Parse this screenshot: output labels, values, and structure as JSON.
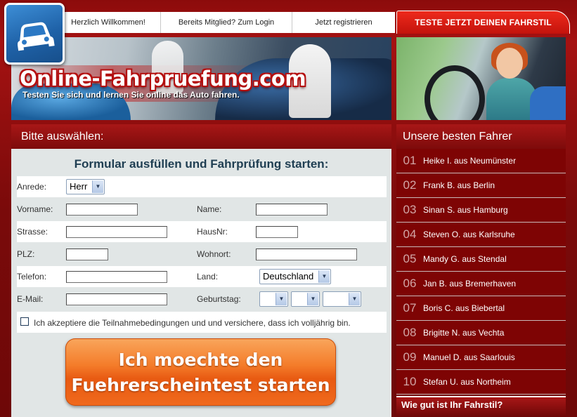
{
  "nav": {
    "items": [
      {
        "label": "Herzlich Willkommen!"
      },
      {
        "label": "Bereits Mitglied? Zum Login"
      },
      {
        "label": "Jetzt registrieren"
      }
    ],
    "cta": "TESTE JETZT DEINEN FAHRSTIL"
  },
  "logo": {
    "icon": "car-icon"
  },
  "banner": {
    "title": "Online-Fahrpruefung.com",
    "slogan": "Testen Sie sich und lernen Sie online das Auto fahren."
  },
  "main": {
    "heading": "Bitte auswählen:",
    "form": {
      "title": "Formular ausfüllen und Fahrprüfung starten:",
      "anrede_label": "Anrede:",
      "anrede_value": "Herr",
      "vorname_label": "Vorname:",
      "name_label": "Name:",
      "strasse_label": "Strasse:",
      "hausnr_label": "HausNr:",
      "plz_label": "PLZ:",
      "wohnort_label": "Wohnort:",
      "telefon_label": "Telefon:",
      "land_label": "Land:",
      "land_value": "Deutschland",
      "email_label": "E-Mail:",
      "geburtstag_label": "Geburtstag:",
      "terms_label": "Ich akzeptiere die Teilnahmebedingungen und und versichere, dass ich volljährig bin.",
      "start_line1": "Ich moechte den",
      "start_line2": "Fuehrerscheintest starten"
    }
  },
  "sidebar": {
    "heading": "Unsere besten Fahrer",
    "drivers": [
      {
        "rank": "01",
        "name": "Heike I. aus Neumünster"
      },
      {
        "rank": "02",
        "name": "Frank B. aus Berlin"
      },
      {
        "rank": "03",
        "name": "Sinan S. aus Hamburg"
      },
      {
        "rank": "04",
        "name": "Steven O. aus Karlsruhe"
      },
      {
        "rank": "05",
        "name": "Mandy G. aus Stendal"
      },
      {
        "rank": "06",
        "name": "Jan B. aus Bremerhaven"
      },
      {
        "rank": "07",
        "name": "Boris C. aus Biebertal"
      },
      {
        "rank": "08",
        "name": "Brigitte N. aus Vechta"
      },
      {
        "rank": "09",
        "name": "Manuel D. aus Saarlouis"
      },
      {
        "rank": "10",
        "name": "Stefan U. aus Northeim"
      }
    ],
    "footer_heading": "Wie gut ist Ihr Fahrstil?"
  },
  "colors": {
    "brand_red": "#8c0b0b",
    "cta_orange": "#f47c2a",
    "form_title": "#1f3e52"
  }
}
